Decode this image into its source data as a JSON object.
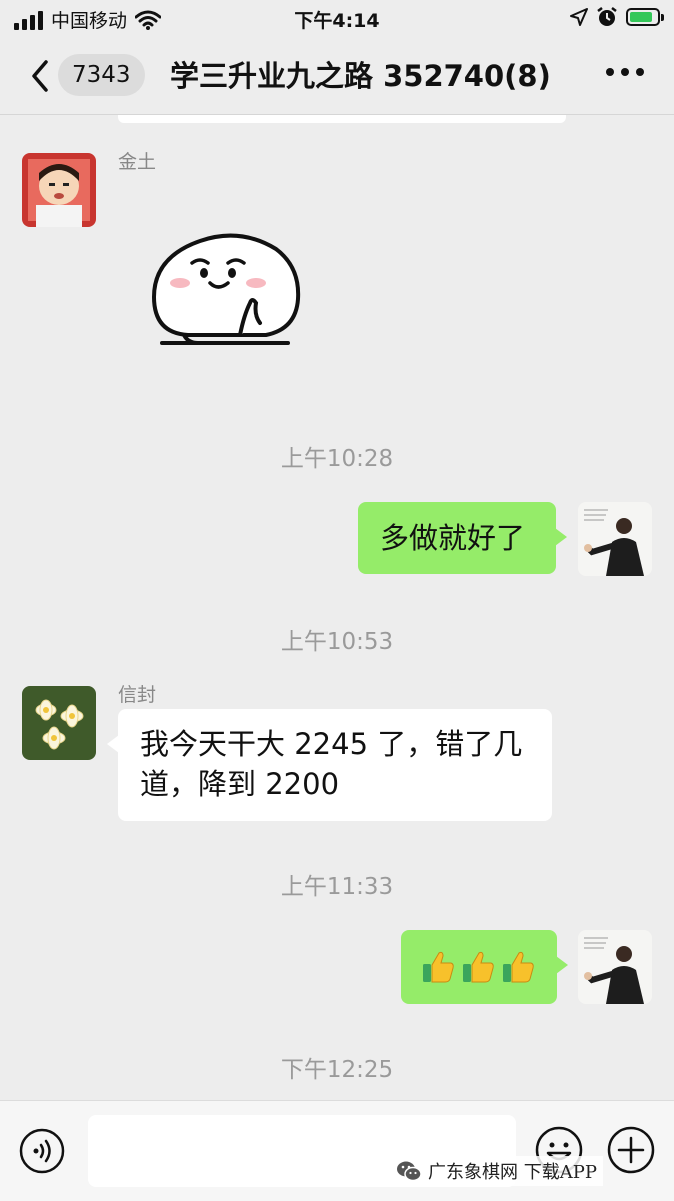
{
  "status_bar": {
    "carrier": "中国移动",
    "time": "下午4:14",
    "battery_level": 0.85
  },
  "nav": {
    "unread_count": "7343",
    "title": "学三升业九之路 352740(8)",
    "back_icon": "chevron-left-icon",
    "more_icon": "more-dots-icon"
  },
  "messages": [
    {
      "type": "sticker",
      "direction": "in",
      "sender": "金土",
      "avatar": "cartoon-boy-avatar",
      "sticker": "shy-blob-sticker"
    },
    {
      "type": "time",
      "text": "上午10:28"
    },
    {
      "type": "text",
      "direction": "out",
      "text": "多做就好了",
      "avatar": "martial-artist-avatar"
    },
    {
      "type": "time",
      "text": "上午10:53"
    },
    {
      "type": "text",
      "direction": "in",
      "sender": "信封",
      "avatar": "flower-avatar",
      "line1": "我今天干大 2245 了，错了几",
      "line2": "道，降到 2200"
    },
    {
      "type": "time",
      "text": "上午11:33"
    },
    {
      "type": "emoji",
      "direction": "out",
      "emojis": [
        "thumbs-up",
        "thumbs-up",
        "thumbs-up"
      ],
      "avatar": "martial-artist-avatar"
    },
    {
      "type": "time",
      "text": "下午12:25"
    }
  ],
  "input_bar": {
    "text_value": "",
    "voice_icon": "voice-icon",
    "emoji_icon": "emoji-face-icon",
    "plus_icon": "plus-circle-icon"
  },
  "watermark": {
    "text": "广东象棋网 下载APP",
    "icon": "wechat-icon"
  },
  "colors": {
    "background": "#ededed",
    "outgoing_bubble": "#95ec69",
    "incoming_bubble": "#ffffff",
    "timestamp": "#9a9a9a"
  }
}
